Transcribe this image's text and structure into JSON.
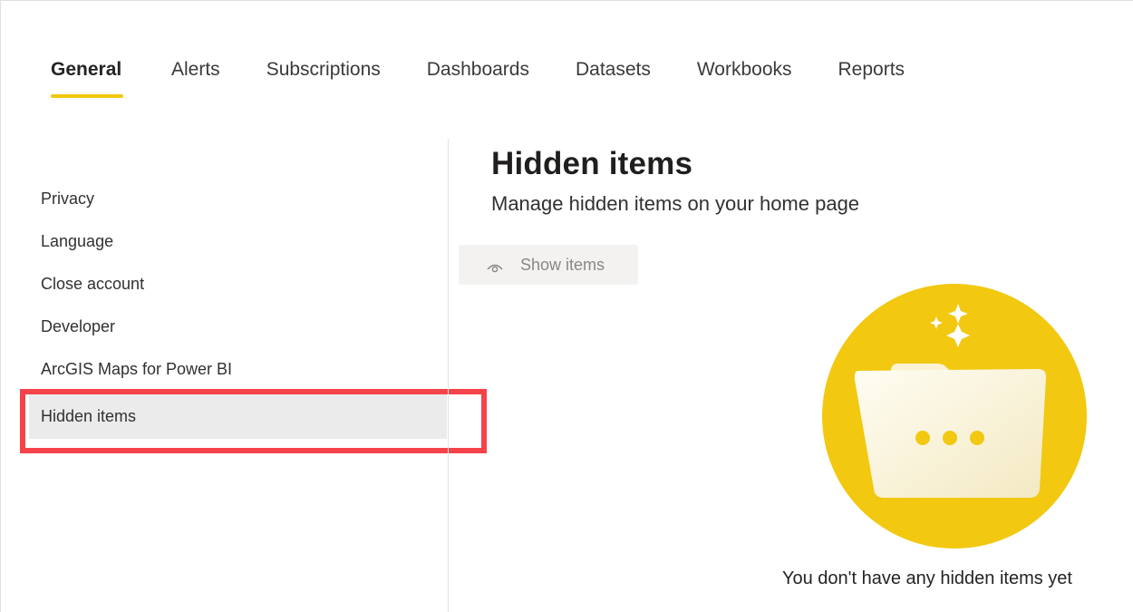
{
  "tabs": [
    {
      "label": "General",
      "active": true
    },
    {
      "label": "Alerts",
      "active": false
    },
    {
      "label": "Subscriptions",
      "active": false
    },
    {
      "label": "Dashboards",
      "active": false
    },
    {
      "label": "Datasets",
      "active": false
    },
    {
      "label": "Workbooks",
      "active": false
    },
    {
      "label": "Reports",
      "active": false
    }
  ],
  "sidebar": {
    "items": [
      {
        "label": "Privacy"
      },
      {
        "label": "Language"
      },
      {
        "label": "Close account"
      },
      {
        "label": "Developer"
      },
      {
        "label": "ArcGIS Maps for Power BI"
      },
      {
        "label": "Hidden items",
        "selected": true
      }
    ]
  },
  "main": {
    "title": "Hidden items",
    "subtitle": "Manage hidden items on your home page",
    "show_button": {
      "label": "Show items",
      "icon": "eye-icon",
      "disabled": true
    },
    "empty_state": {
      "message": "You don't have any hidden items yet",
      "illustration": "folder-sparkle-icon"
    }
  },
  "colors": {
    "accent": "#f2c811",
    "highlight": "#f5434a",
    "selected_bg": "#ebebeb",
    "button_bg": "#f3f2f1"
  }
}
